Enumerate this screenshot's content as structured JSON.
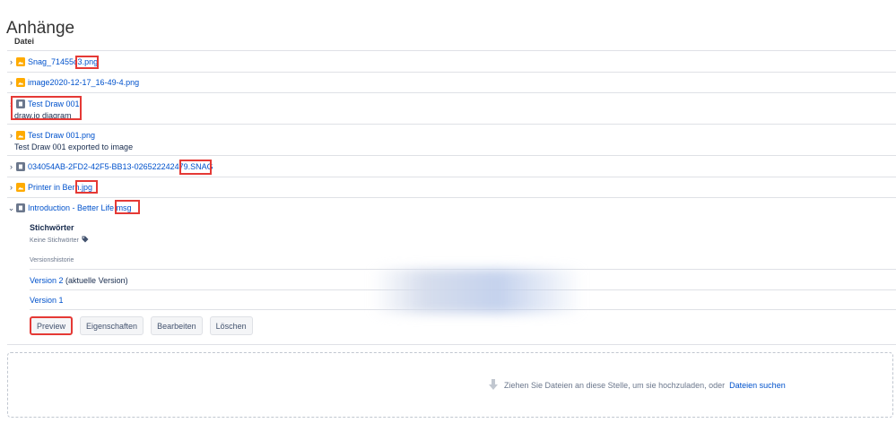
{
  "page": {
    "title": "Anhänge",
    "column_header": "Datei"
  },
  "files": [
    {
      "name_main": "Snag_71455c3",
      "name_ext": ".png",
      "type": "image",
      "expanded": false,
      "description": ""
    },
    {
      "name_main": "image2020-12-17_16-49-4.png",
      "name_ext": "",
      "type": "image",
      "expanded": false,
      "description": ""
    },
    {
      "name_main": "Test Draw 001",
      "name_ext": "",
      "type": "doc",
      "expanded": false,
      "description": "draw.io diagram"
    },
    {
      "name_main": "Test Draw 001.png",
      "name_ext": "",
      "type": "image",
      "expanded": false,
      "description": "Test Draw 001 exported to image"
    },
    {
      "name_main": "034054AB-2FD2-42F5-BB13-026522242479",
      "name_ext": ".SNAG",
      "type": "doc",
      "expanded": false,
      "description": ""
    },
    {
      "name_main": "Printer in Bern",
      "name_ext": ".jpg",
      "type": "image",
      "expanded": false,
      "description": ""
    },
    {
      "name_main": "Introduction - Better Life",
      "name_ext": ".msg",
      "type": "doc",
      "expanded": true,
      "description": ""
    }
  ],
  "details": {
    "labels_title": "Stichwörter",
    "labels_none": "Keine Stichwörter",
    "version_history_label": "Versionshistorie",
    "versions": [
      {
        "link": "Version 2",
        "note": "(aktuelle Version)"
      },
      {
        "link": "Version 1",
        "note": ""
      }
    ],
    "buttons": {
      "preview": "Preview",
      "properties": "Eigenschaften",
      "edit": "Bearbeiten",
      "delete": "Löschen"
    }
  },
  "dropzone": {
    "text": "Ziehen Sie Dateien an diese Stelle, um sie hochzuladen, oder",
    "link": "Dateien suchen"
  },
  "icons": {
    "collapsed": "chevron-right-icon",
    "expanded": "chevron-down-icon",
    "image_file": "image-file-icon",
    "document_file": "document-file-icon",
    "label": "tag-icon",
    "upload": "arrow-down-icon"
  },
  "colors": {
    "link": "#0052cc",
    "highlight": "#e53935",
    "image_icon": "#ffab00",
    "doc_icon": "#6b778c"
  }
}
